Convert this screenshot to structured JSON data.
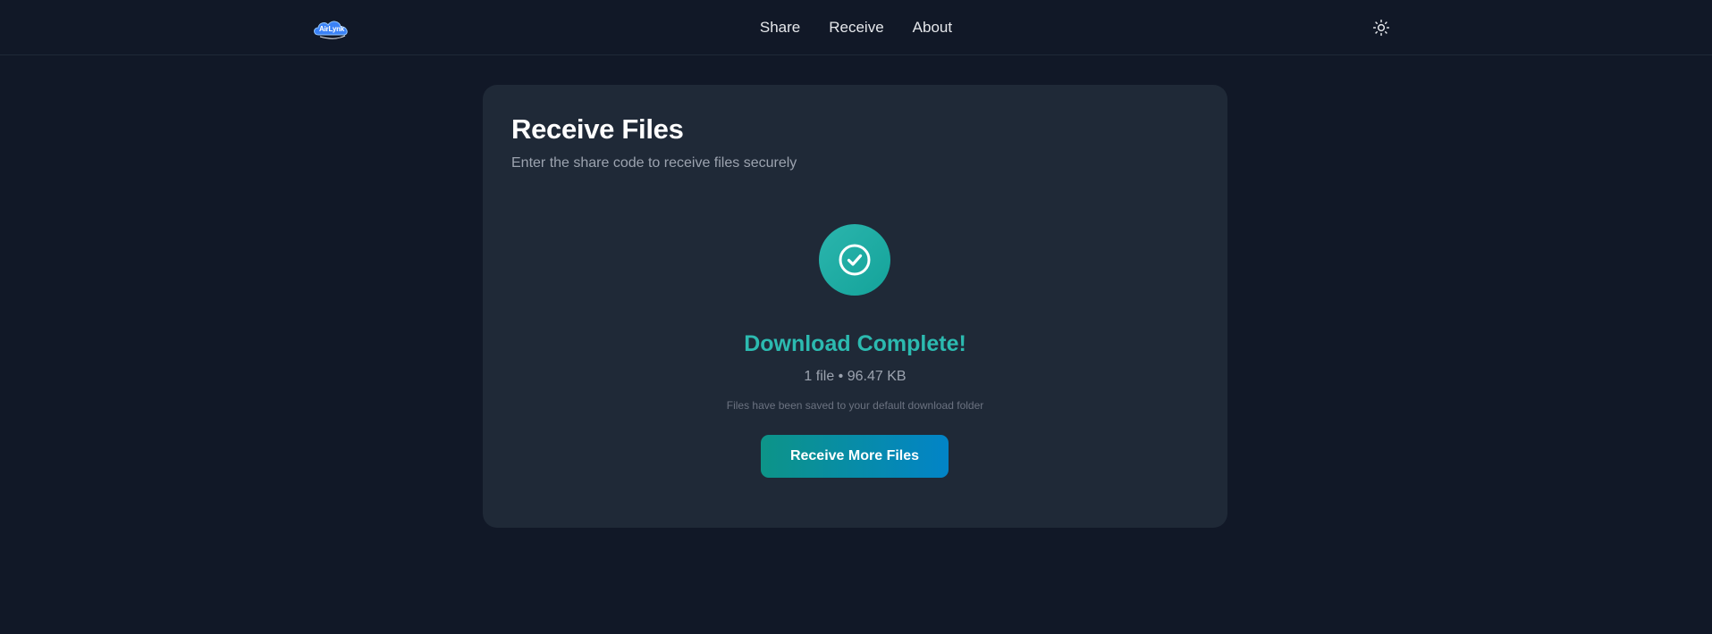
{
  "header": {
    "logo_text": "AirLynk",
    "nav": [
      {
        "label": "Share"
      },
      {
        "label": "Receive"
      },
      {
        "label": "About"
      }
    ],
    "theme_toggle_icon": "sun-icon"
  },
  "card": {
    "title": "Receive Files",
    "subtitle": "Enter the share code to receive files securely",
    "status": {
      "icon": "check-circle-icon",
      "title": "Download Complete!",
      "file_count": "1 file",
      "separator": "•",
      "size": "96.47 KB",
      "note": "Files have been saved to your default download folder"
    },
    "button_label": "Receive More Files"
  },
  "colors": {
    "background": "#111827",
    "card": "#1f2937",
    "accent_teal": "#2cbab0",
    "button_gradient_start": "#0d9488",
    "button_gradient_end": "#0284c7"
  }
}
